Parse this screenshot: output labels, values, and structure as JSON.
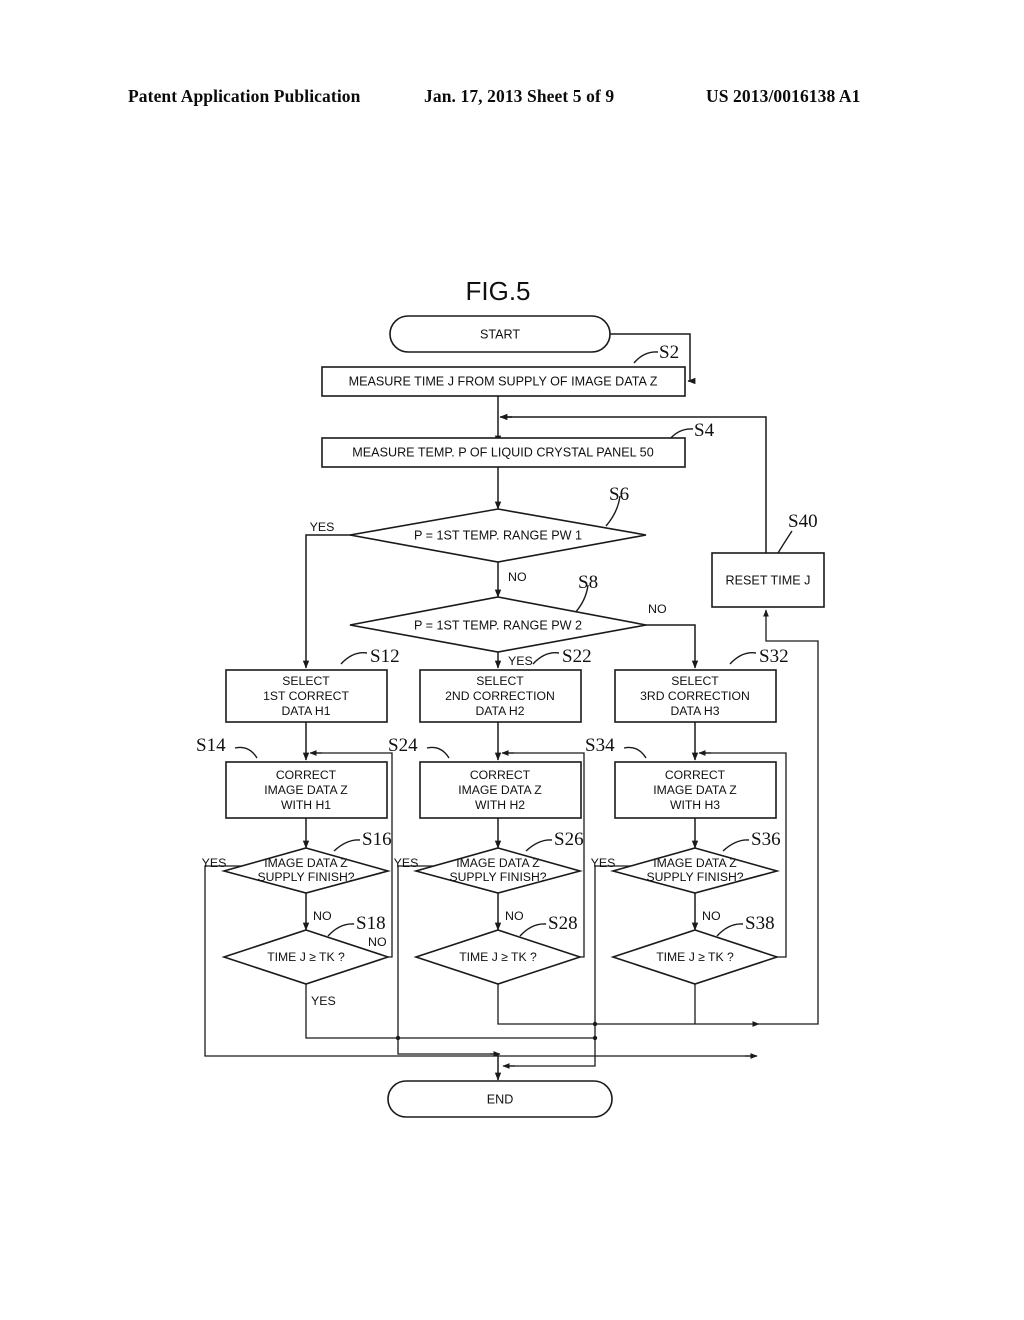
{
  "header": {
    "left": "Patent Application Publication",
    "middle": "Jan. 17, 2013  Sheet 5 of 9",
    "right": "US 2013/0016138 A1"
  },
  "figure": {
    "title": "FIG.5",
    "nodes": {
      "start": {
        "label": "START",
        "shape": "terminator"
      },
      "s2": {
        "step": "S2",
        "label": "MEASURE TIME J FROM SUPPLY OF IMAGE DATA Z",
        "shape": "process"
      },
      "s4": {
        "step": "S4",
        "label": "MEASURE TEMP. P OF LIQUID CRYSTAL PANEL 50",
        "shape": "process"
      },
      "s6": {
        "step": "S6",
        "label": "P = 1ST TEMP. RANGE PW 1",
        "shape": "decision"
      },
      "s8": {
        "step": "S8",
        "label": "P = 1ST TEMP. RANGE PW 2",
        "shape": "decision"
      },
      "s40": {
        "step": "S40",
        "label": "RESET TIME J",
        "shape": "process"
      },
      "s12": {
        "step": "S12",
        "line1": "SELECT",
        "line2": "1ST CORRECT",
        "line3": "DATA H1",
        "shape": "process"
      },
      "s22": {
        "step": "S22",
        "line1": "SELECT",
        "line2": "2ND CORRECTION",
        "line3": "DATA H2",
        "shape": "process"
      },
      "s32": {
        "step": "S32",
        "line1": "SELECT",
        "line2": "3RD CORRECTION",
        "line3": "DATA H3",
        "shape": "process"
      },
      "s14": {
        "step": "S14",
        "line1": "CORRECT",
        "line2": "IMAGE DATA Z",
        "line3": "WITH H1",
        "shape": "process"
      },
      "s24": {
        "step": "S24",
        "line1": "CORRECT",
        "line2": "IMAGE DATA Z",
        "line3": "WITH H2",
        "shape": "process"
      },
      "s34": {
        "step": "S34",
        "line1": "CORRECT",
        "line2": "IMAGE DATA Z",
        "line3": "WITH H3",
        "shape": "process"
      },
      "s16": {
        "step": "S16",
        "line1": "IMAGE DATA Z",
        "line2": "SUPPLY FINISH?",
        "shape": "decision"
      },
      "s26": {
        "step": "S26",
        "line1": "IMAGE DATA Z",
        "line2": "SUPPLY FINISH?",
        "shape": "decision"
      },
      "s36": {
        "step": "S36",
        "line1": "IMAGE DATA Z",
        "line2": "SUPPLY FINISH?",
        "shape": "decision"
      },
      "s18": {
        "step": "S18",
        "label": "TIME J ≥ TK ?",
        "shape": "decision"
      },
      "s28": {
        "step": "S28",
        "label": "TIME J ≥ TK ?",
        "shape": "decision"
      },
      "s38": {
        "step": "S38",
        "label": "TIME J ≥ TK ?",
        "shape": "decision"
      },
      "end": {
        "label": "END",
        "shape": "terminator"
      }
    },
    "edge_labels": {
      "s6_yes": "YES",
      "s6_no": "NO",
      "s8_yes": "YES",
      "s8_no": "NO",
      "s16_yes": "YES",
      "s16_no": "NO",
      "s26_yes": "YES",
      "s26_no": "NO",
      "s36_yes": "YES",
      "s36_no": "NO",
      "s18_no": "NO",
      "s18_yes": "YES"
    },
    "colors": {
      "stroke": "#1a1a1a",
      "fill": "#ffffff",
      "text": "#111111"
    }
  }
}
